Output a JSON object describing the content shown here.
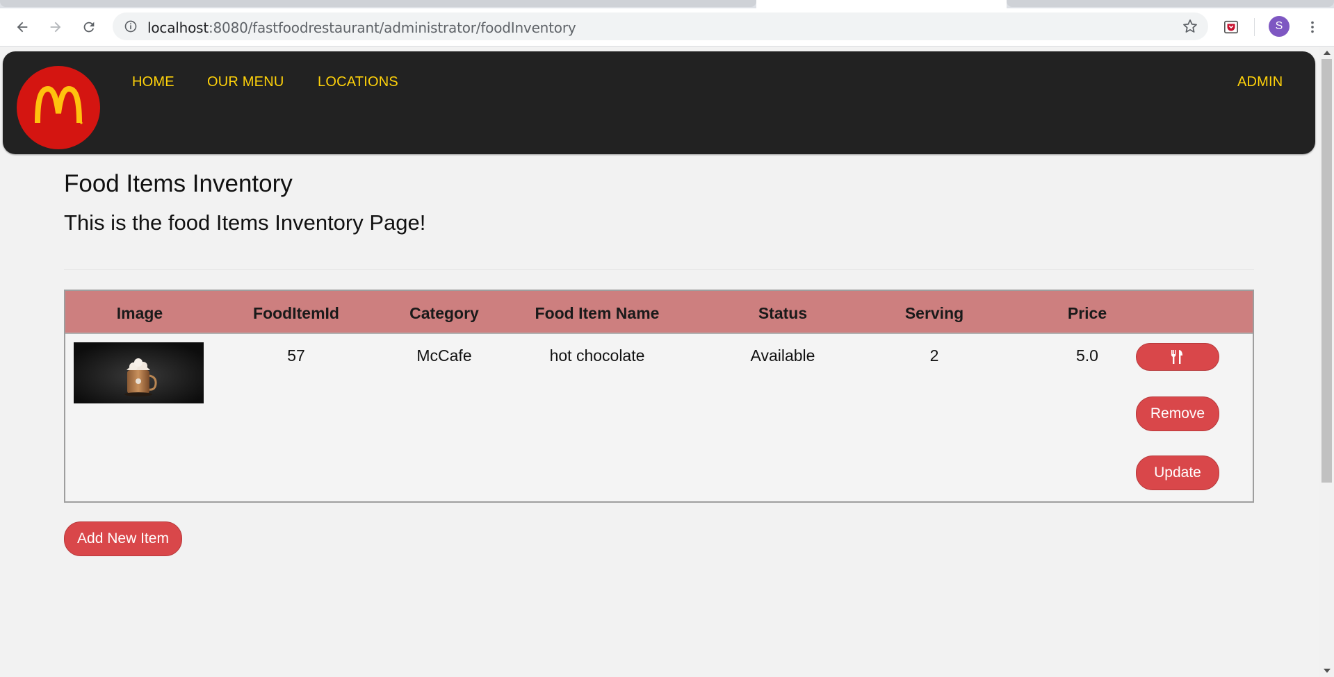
{
  "browser": {
    "url_host": "localhost",
    "url_rest": ":8080/fastfoodrestaurant/administrator/foodInventory",
    "profile_initial": "S"
  },
  "navbar": {
    "links": [
      "HOME",
      "OUR MENU",
      "LOCATIONS"
    ],
    "admin_label": "ADMIN"
  },
  "page": {
    "title": "Food Items Inventory",
    "subtitle": "This is the food Items Inventory Page!"
  },
  "table": {
    "headers": [
      "Image",
      "FoodItemId",
      "Category",
      "Food Item Name",
      "Status",
      "Serving",
      "Price"
    ],
    "rows": [
      {
        "food_item_id": "57",
        "category": "McCafe",
        "name": "hot chocolate",
        "status": "Available",
        "serving": "2",
        "price": "5.0",
        "actions": {
          "icon": "utensils-icon",
          "remove": "Remove",
          "update": "Update"
        }
      }
    ]
  },
  "add_button": "Add New Item",
  "colors": {
    "navbar_bg": "#222222",
    "nav_link": "#ffd20a",
    "header_row": "#cd7f7f",
    "button": "#d9474a",
    "logo_bg": "#d41511",
    "logo_arches": "#ffc20e"
  }
}
